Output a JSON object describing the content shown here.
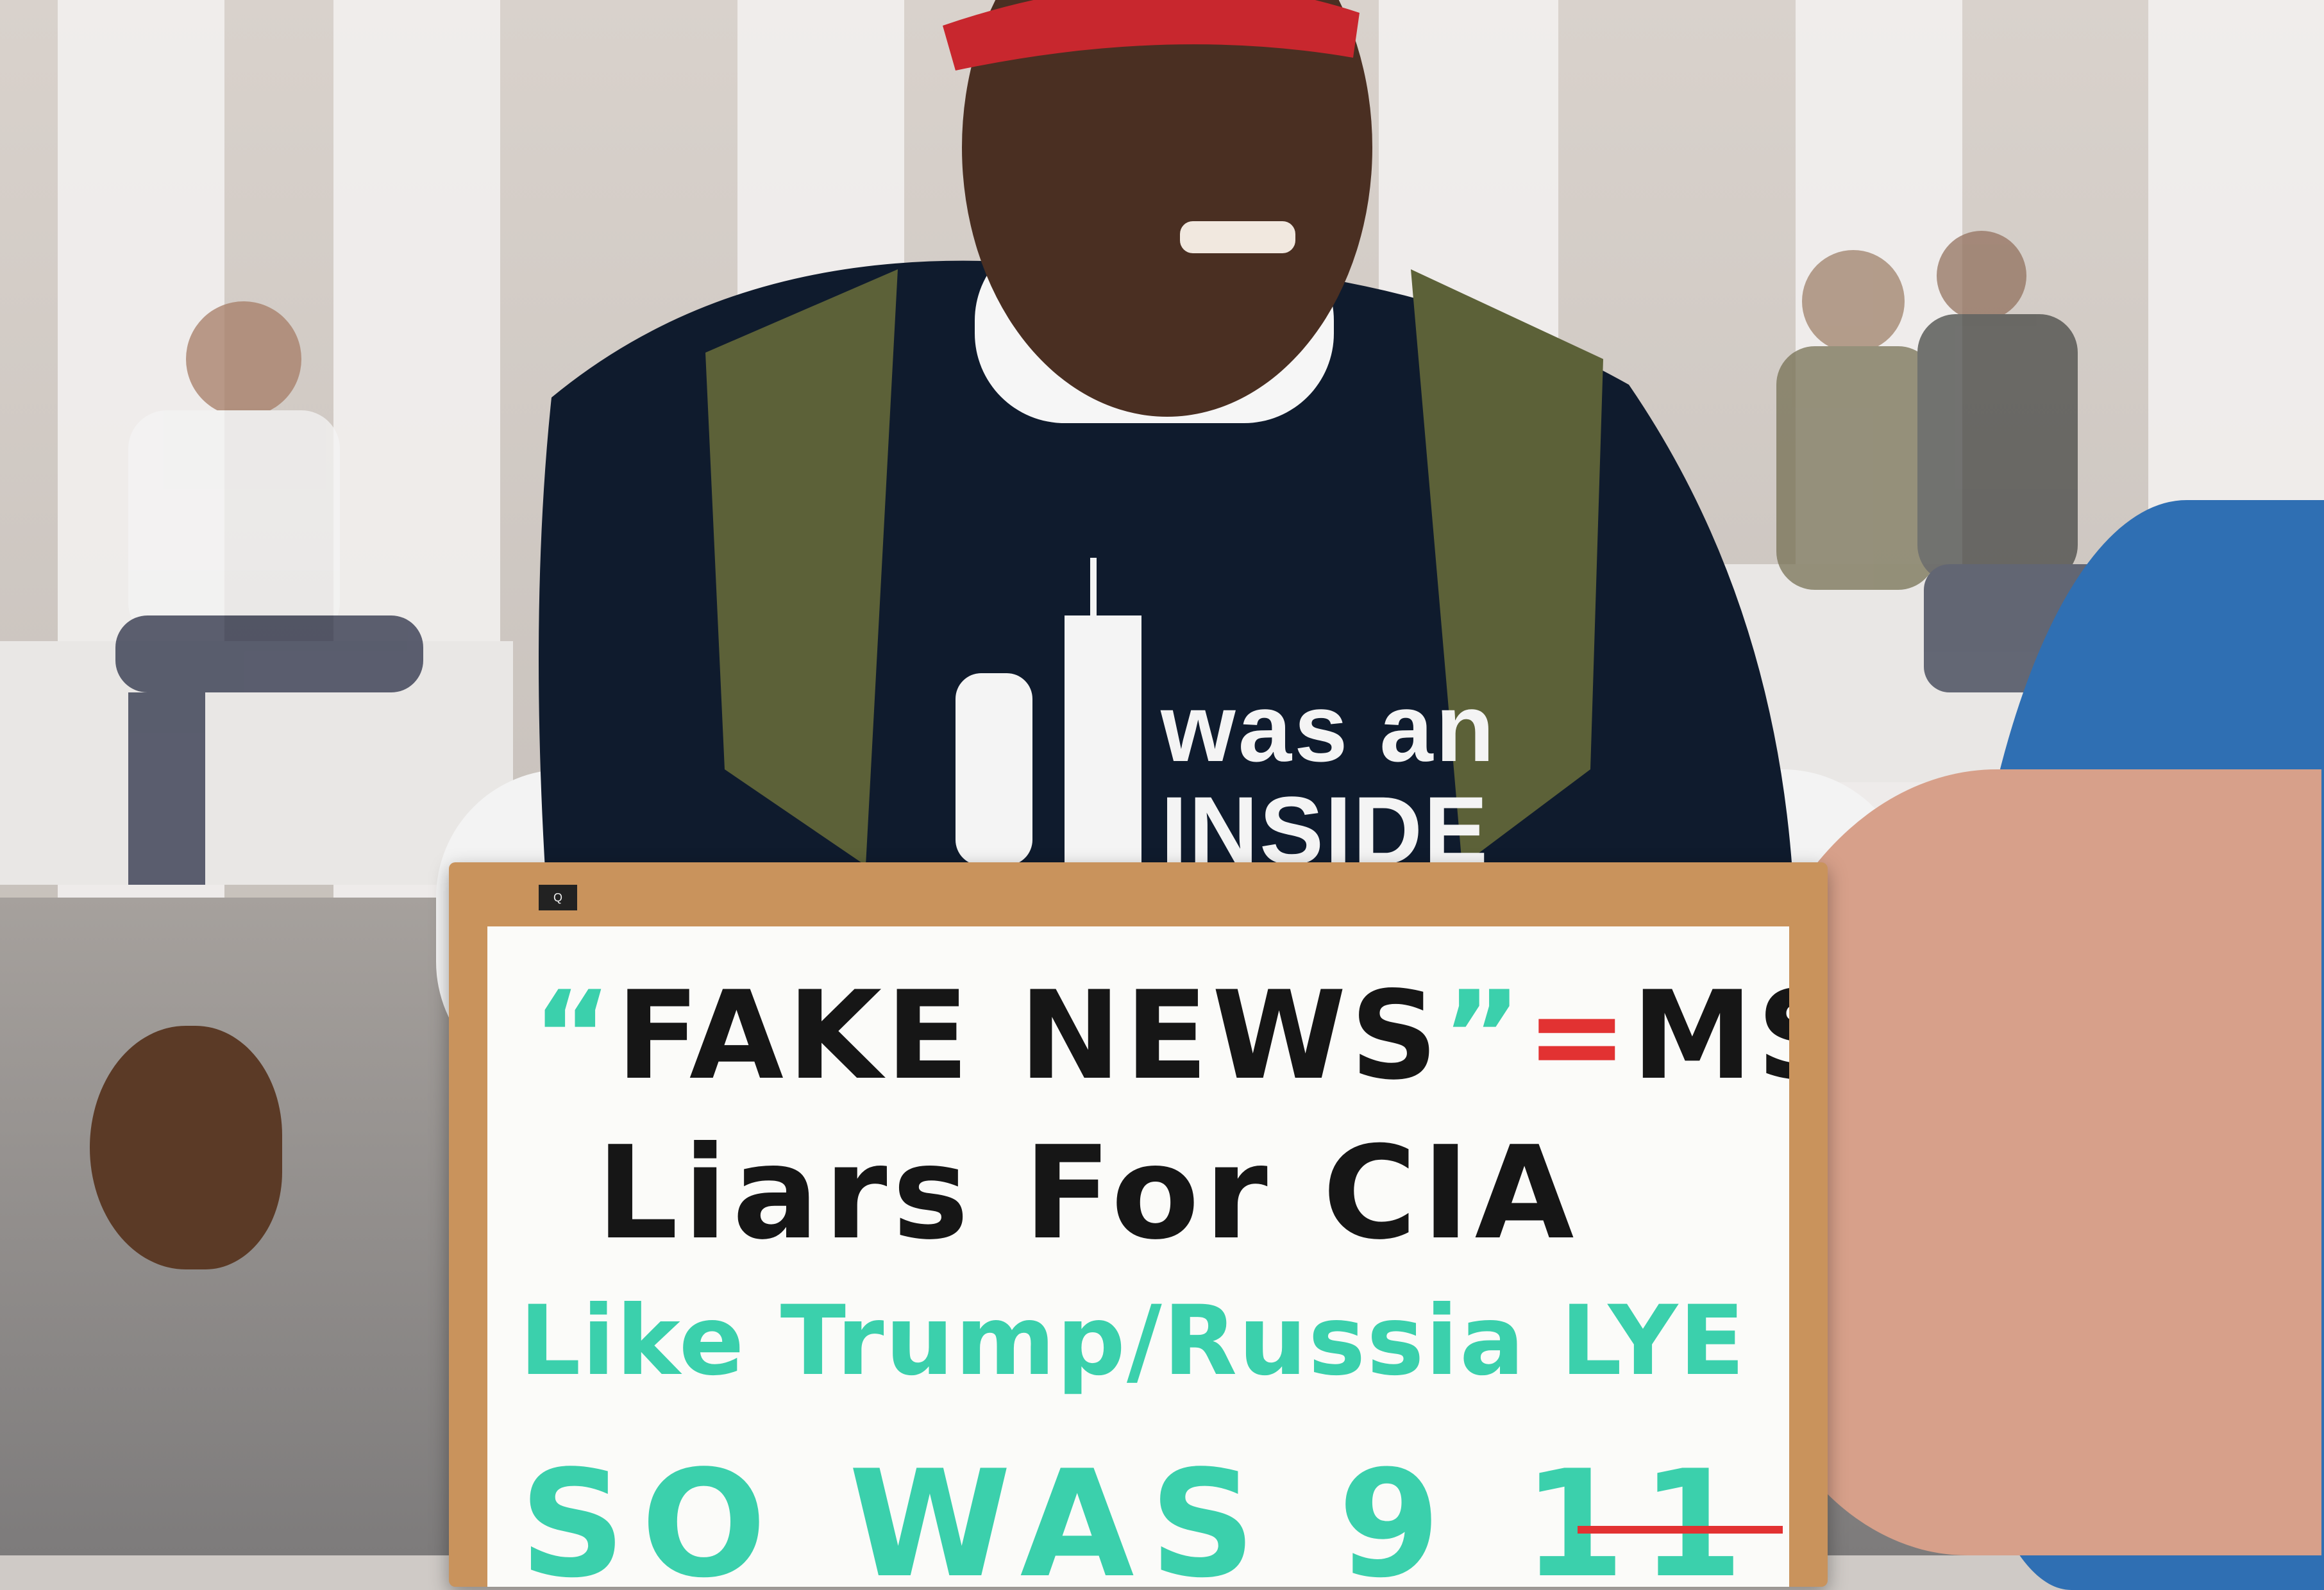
{
  "photo": {
    "shirt_text": {
      "line1": "was an",
      "line2": "INSIDE"
    },
    "sign": {
      "line1_quote_open": "“",
      "line1_text": "FAKE NEWS",
      "line1_quote_close": "”",
      "line1_equals": "=",
      "line1_tail": "MSM",
      "line2": "Liars For CIA",
      "line3": "Like Trump/Russia LYE",
      "line4": "SO WAS 9 11"
    },
    "colors": {
      "sign_black": "#161616",
      "sign_teal": "#3bd0ac",
      "sign_red": "#e23232",
      "shirt": "#0f1b2d",
      "cap": "#c8272e"
    }
  }
}
